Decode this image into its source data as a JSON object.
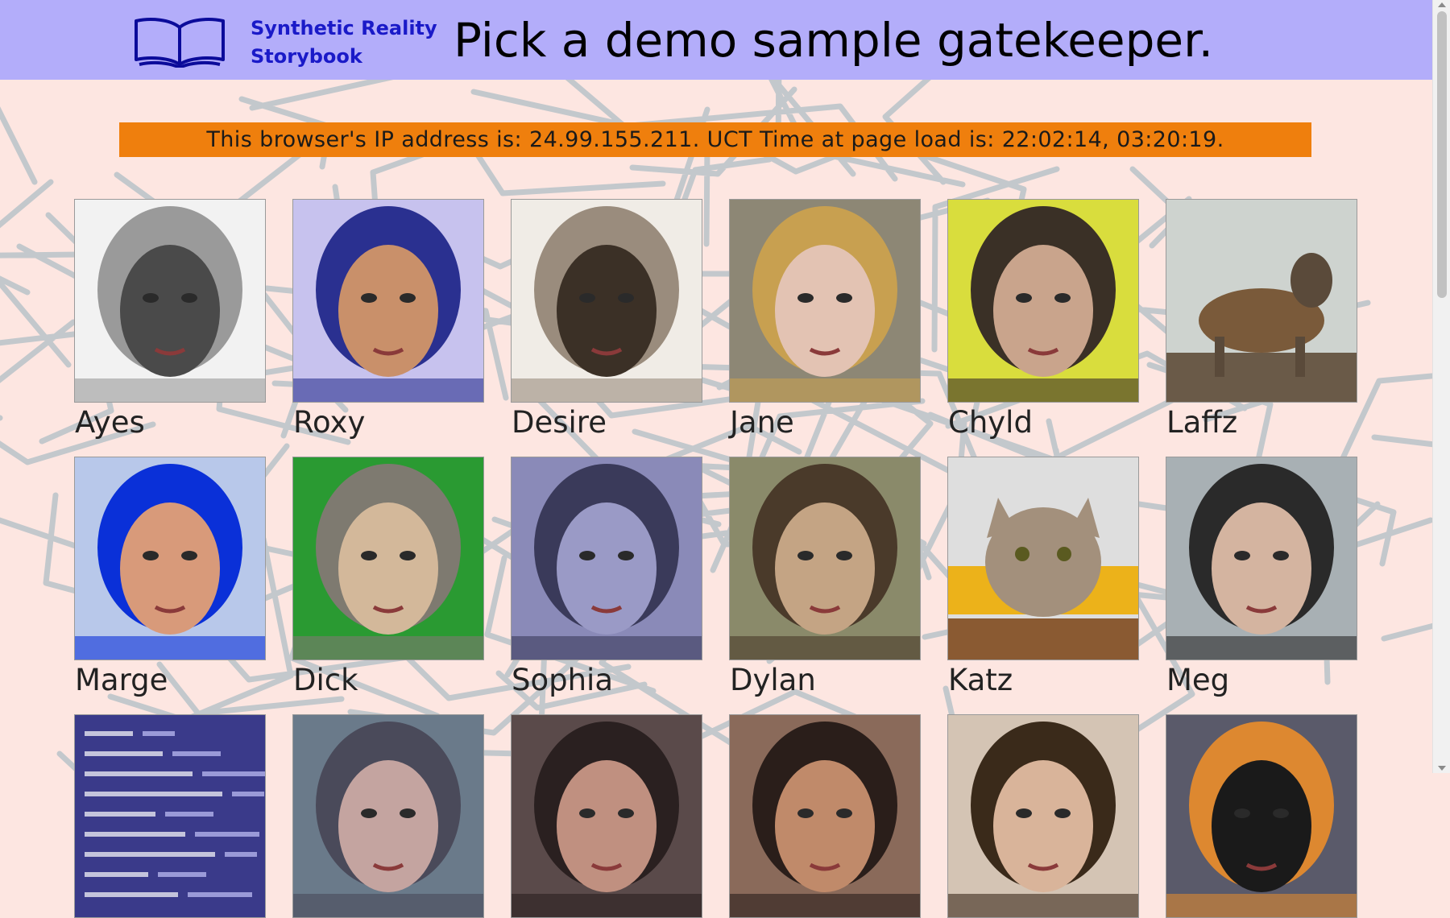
{
  "header": {
    "brand_line1": "Synthetic Reality",
    "brand_line2": "Storybook",
    "title": "Pick a demo sample gatekeeper.",
    "logo_icon": "open-book-icon"
  },
  "info_bar": {
    "text": "This browser's IP address is: 24.99.155.211.  UCT Time at page load is: 22:02:14, 03:20:19."
  },
  "colors": {
    "header_bg": "#b3adfa",
    "brand_text": "#1a1ac8",
    "info_bar_bg": "#ef7f0d",
    "page_bg": "#fde6e1",
    "pattern_lines": "#c3c8cc"
  },
  "gatekeepers": [
    {
      "name": "Ayes",
      "id": "ayes",
      "palette": [
        "#f2f2f2",
        "#9a9a9a",
        "#4a4a4a"
      ]
    },
    {
      "name": "Roxy",
      "id": "roxy",
      "palette": [
        "#c7c2ee",
        "#2a3090",
        "#c9906a"
      ]
    },
    {
      "name": "Desire",
      "id": "desire",
      "palette": [
        "#f0ece6",
        "#9a8c7d",
        "#3b3026"
      ]
    },
    {
      "name": "Jane",
      "id": "jane",
      "palette": [
        "#8d8775",
        "#c8a050",
        "#e3c3b3"
      ]
    },
    {
      "name": "Chyld",
      "id": "chyld",
      "palette": [
        "#d9dd3d",
        "#3a3026",
        "#c9a48c"
      ]
    },
    {
      "name": "Laffz",
      "id": "laffz",
      "palette": [
        "#ced3cf",
        "#7a5a3a",
        "#5a4a3a"
      ]
    },
    {
      "name": "Marge",
      "id": "marge",
      "palette": [
        "#b8c8ea",
        "#0a30d8",
        "#d89a7a"
      ]
    },
    {
      "name": "Dick",
      "id": "dick",
      "palette": [
        "#2a9a32",
        "#7e7a70",
        "#d3b89a"
      ]
    },
    {
      "name": "Sophia",
      "id": "sophia",
      "palette": [
        "#8a8ab8",
        "#3a3a5a",
        "#9a9ac6"
      ]
    },
    {
      "name": "Dylan",
      "id": "dylan",
      "palette": [
        "#8a8a6a",
        "#4a3a2a",
        "#c4a484"
      ]
    },
    {
      "name": "Katz",
      "id": "katz",
      "palette": [
        "#dedede",
        "#ecb21a",
        "#a3907c"
      ]
    },
    {
      "name": "Meg",
      "id": "meg",
      "palette": [
        "#a8b0b4",
        "#2a2a2a",
        "#d4b4a0"
      ]
    },
    {
      "name": "",
      "id": "code",
      "palette": [
        "#3a3a8a",
        "#9a9ad8",
        "#ffffff"
      ]
    },
    {
      "name": "",
      "id": "row3-2",
      "palette": [
        "#6a7a8a",
        "#4a4a5a",
        "#c4a4a0"
      ]
    },
    {
      "name": "",
      "id": "row3-3",
      "palette": [
        "#5a4a4a",
        "#2a2020",
        "#c09080"
      ]
    },
    {
      "name": "",
      "id": "row3-4",
      "palette": [
        "#8a6a5a",
        "#2a1e1a",
        "#c08a6a"
      ]
    },
    {
      "name": "",
      "id": "row3-5",
      "palette": [
        "#d4c4b4",
        "#3a2a1a",
        "#d9b49a"
      ]
    },
    {
      "name": "",
      "id": "row3-6",
      "palette": [
        "#5a5a6a",
        "#dd8830",
        "#1a1a1a"
      ]
    }
  ]
}
